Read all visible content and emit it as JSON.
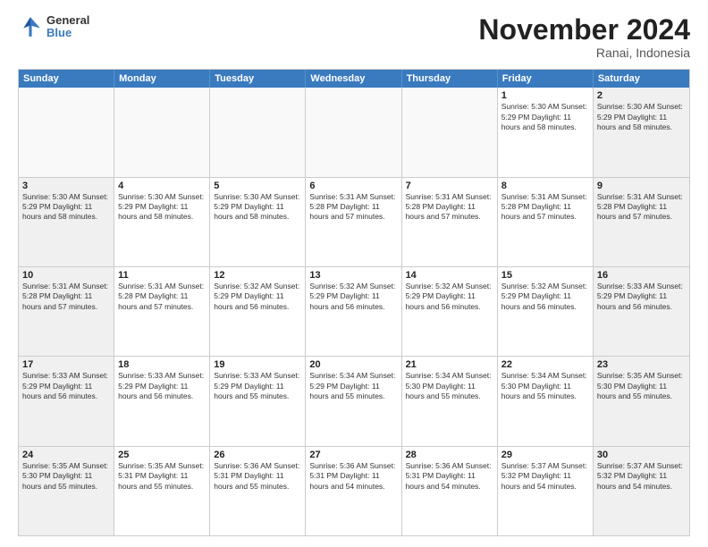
{
  "logo": {
    "general": "General",
    "blue": "Blue"
  },
  "header": {
    "month": "November 2024",
    "location": "Ranai, Indonesia"
  },
  "weekdays": [
    "Sunday",
    "Monday",
    "Tuesday",
    "Wednesday",
    "Thursday",
    "Friday",
    "Saturday"
  ],
  "rows": [
    [
      {
        "day": "",
        "info": "",
        "empty": true
      },
      {
        "day": "",
        "info": "",
        "empty": true
      },
      {
        "day": "",
        "info": "",
        "empty": true
      },
      {
        "day": "",
        "info": "",
        "empty": true
      },
      {
        "day": "",
        "info": "",
        "empty": true
      },
      {
        "day": "1",
        "info": "Sunrise: 5:30 AM\nSunset: 5:29 PM\nDaylight: 11 hours\nand 58 minutes."
      },
      {
        "day": "2",
        "info": "Sunrise: 5:30 AM\nSunset: 5:29 PM\nDaylight: 11 hours\nand 58 minutes.",
        "shaded": true
      }
    ],
    [
      {
        "day": "3",
        "info": "Sunrise: 5:30 AM\nSunset: 5:29 PM\nDaylight: 11 hours\nand 58 minutes.",
        "shaded": true
      },
      {
        "day": "4",
        "info": "Sunrise: 5:30 AM\nSunset: 5:29 PM\nDaylight: 11 hours\nand 58 minutes."
      },
      {
        "day": "5",
        "info": "Sunrise: 5:30 AM\nSunset: 5:29 PM\nDaylight: 11 hours\nand 58 minutes."
      },
      {
        "day": "6",
        "info": "Sunrise: 5:31 AM\nSunset: 5:28 PM\nDaylight: 11 hours\nand 57 minutes."
      },
      {
        "day": "7",
        "info": "Sunrise: 5:31 AM\nSunset: 5:28 PM\nDaylight: 11 hours\nand 57 minutes."
      },
      {
        "day": "8",
        "info": "Sunrise: 5:31 AM\nSunset: 5:28 PM\nDaylight: 11 hours\nand 57 minutes."
      },
      {
        "day": "9",
        "info": "Sunrise: 5:31 AM\nSunset: 5:28 PM\nDaylight: 11 hours\nand 57 minutes.",
        "shaded": true
      }
    ],
    [
      {
        "day": "10",
        "info": "Sunrise: 5:31 AM\nSunset: 5:28 PM\nDaylight: 11 hours\nand 57 minutes.",
        "shaded": true
      },
      {
        "day": "11",
        "info": "Sunrise: 5:31 AM\nSunset: 5:28 PM\nDaylight: 11 hours\nand 57 minutes."
      },
      {
        "day": "12",
        "info": "Sunrise: 5:32 AM\nSunset: 5:29 PM\nDaylight: 11 hours\nand 56 minutes."
      },
      {
        "day": "13",
        "info": "Sunrise: 5:32 AM\nSunset: 5:29 PM\nDaylight: 11 hours\nand 56 minutes."
      },
      {
        "day": "14",
        "info": "Sunrise: 5:32 AM\nSunset: 5:29 PM\nDaylight: 11 hours\nand 56 minutes."
      },
      {
        "day": "15",
        "info": "Sunrise: 5:32 AM\nSunset: 5:29 PM\nDaylight: 11 hours\nand 56 minutes."
      },
      {
        "day": "16",
        "info": "Sunrise: 5:33 AM\nSunset: 5:29 PM\nDaylight: 11 hours\nand 56 minutes.",
        "shaded": true
      }
    ],
    [
      {
        "day": "17",
        "info": "Sunrise: 5:33 AM\nSunset: 5:29 PM\nDaylight: 11 hours\nand 56 minutes.",
        "shaded": true
      },
      {
        "day": "18",
        "info": "Sunrise: 5:33 AM\nSunset: 5:29 PM\nDaylight: 11 hours\nand 56 minutes."
      },
      {
        "day": "19",
        "info": "Sunrise: 5:33 AM\nSunset: 5:29 PM\nDaylight: 11 hours\nand 55 minutes."
      },
      {
        "day": "20",
        "info": "Sunrise: 5:34 AM\nSunset: 5:29 PM\nDaylight: 11 hours\nand 55 minutes."
      },
      {
        "day": "21",
        "info": "Sunrise: 5:34 AM\nSunset: 5:30 PM\nDaylight: 11 hours\nand 55 minutes."
      },
      {
        "day": "22",
        "info": "Sunrise: 5:34 AM\nSunset: 5:30 PM\nDaylight: 11 hours\nand 55 minutes."
      },
      {
        "day": "23",
        "info": "Sunrise: 5:35 AM\nSunset: 5:30 PM\nDaylight: 11 hours\nand 55 minutes.",
        "shaded": true
      }
    ],
    [
      {
        "day": "24",
        "info": "Sunrise: 5:35 AM\nSunset: 5:30 PM\nDaylight: 11 hours\nand 55 minutes.",
        "shaded": true
      },
      {
        "day": "25",
        "info": "Sunrise: 5:35 AM\nSunset: 5:31 PM\nDaylight: 11 hours\nand 55 minutes."
      },
      {
        "day": "26",
        "info": "Sunrise: 5:36 AM\nSunset: 5:31 PM\nDaylight: 11 hours\nand 55 minutes."
      },
      {
        "day": "27",
        "info": "Sunrise: 5:36 AM\nSunset: 5:31 PM\nDaylight: 11 hours\nand 54 minutes."
      },
      {
        "day": "28",
        "info": "Sunrise: 5:36 AM\nSunset: 5:31 PM\nDaylight: 11 hours\nand 54 minutes."
      },
      {
        "day": "29",
        "info": "Sunrise: 5:37 AM\nSunset: 5:32 PM\nDaylight: 11 hours\nand 54 minutes."
      },
      {
        "day": "30",
        "info": "Sunrise: 5:37 AM\nSunset: 5:32 PM\nDaylight: 11 hours\nand 54 minutes.",
        "shaded": true
      }
    ]
  ]
}
